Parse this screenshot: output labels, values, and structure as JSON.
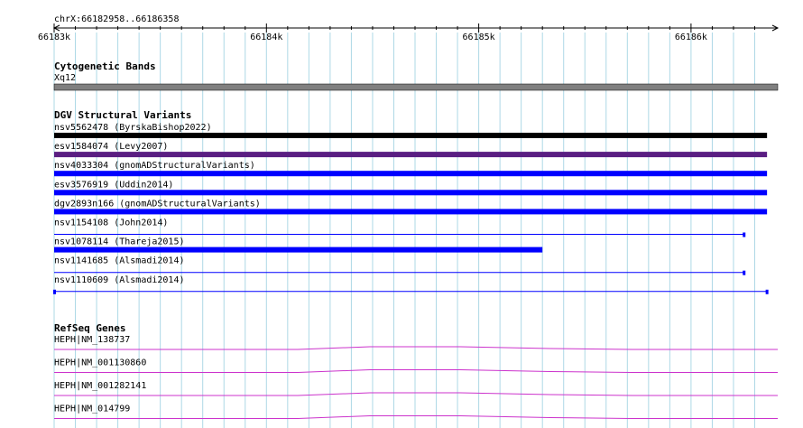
{
  "ruler": {
    "region_label": "chrX:66182958..66186358",
    "start": 66182958,
    "end": 66186358,
    "ticks": [
      {
        "label": "66183k",
        "pos": 66183000
      },
      {
        "label": "66184k",
        "pos": 66184000
      },
      {
        "label": "66185k",
        "pos": 66185000
      },
      {
        "label": "66186k",
        "pos": 66186000
      }
    ]
  },
  "tracks": {
    "cytoband": {
      "title": "Cytogenetic Bands",
      "band_label": "Xq12",
      "color": "#808080"
    },
    "dgv": {
      "title": "DGV Structural Variants",
      "items": [
        {
          "label": "nsv5562478 (ByrskaBishop2022)",
          "style": "thick",
          "color": "#000000",
          "start": 66183000,
          "end": 66186358
        },
        {
          "label": "esv1584074 (Levy2007)",
          "style": "thick",
          "color": "#5a1e82",
          "start": 66183000,
          "end": 66186358
        },
        {
          "label": "nsv4033304 (gnomADStructuralVariants)",
          "style": "thick",
          "color": "#0000ff",
          "start": 66183000,
          "end": 66186358
        },
        {
          "label": "esv3576919 (Uddin2014)",
          "style": "thick",
          "color": "#0000ff",
          "start": 66183000,
          "end": 66186358
        },
        {
          "label": "dgv2893n166 (gnomADStructuralVariants)",
          "style": "thick",
          "color": "#0000ff",
          "start": 66183000,
          "end": 66186358
        },
        {
          "label": "nsv1154108 (John2014)",
          "style": "thin",
          "color": "#0000ff",
          "start": 66183000,
          "end": 66186250
        },
        {
          "label": "nsv1078114 (Thareja2015)",
          "style": "thick",
          "color": "#0000ff",
          "start": 66183000,
          "end": 66185300
        },
        {
          "label": "nsv1141685 (Alsmadi2014)",
          "style": "thin",
          "color": "#0000ff",
          "start": 66183000,
          "end": 66186250
        },
        {
          "label": "nsv1110609 (Alsmadi2014)",
          "style": "thin",
          "color": "#0000ff",
          "start": 66183000,
          "end": 66186358
        }
      ]
    },
    "refseq": {
      "title": "RefSeq Genes",
      "color": "#cc33cc",
      "items": [
        {
          "label": "HEPH|NM_138737"
        },
        {
          "label": "HEPH|NM_001130860"
        },
        {
          "label": "HEPH|NM_001282141"
        },
        {
          "label": "HEPH|NM_014799"
        }
      ]
    }
  },
  "colors": {
    "grid": "#add8e6",
    "ruler": "#000000"
  }
}
